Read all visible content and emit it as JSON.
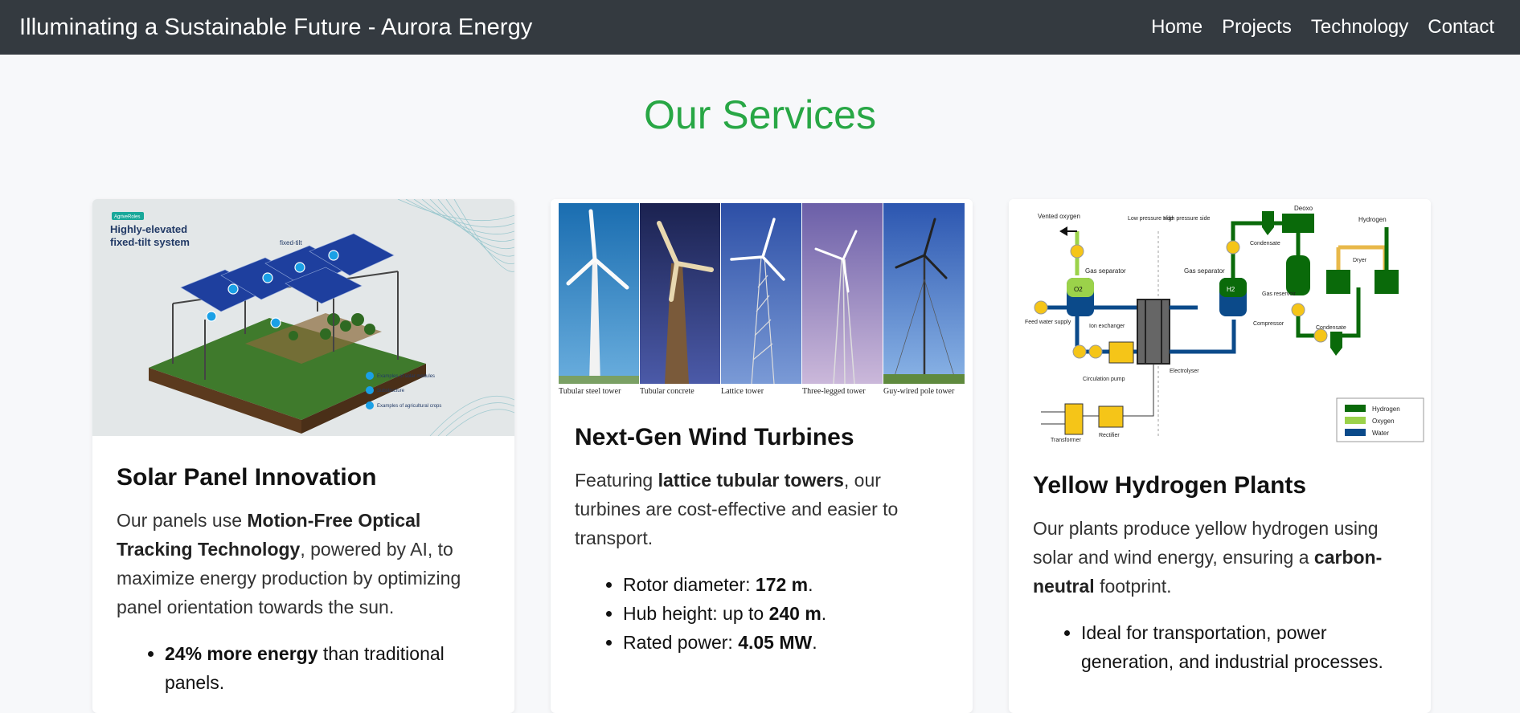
{
  "header": {
    "title": "Illuminating a Sustainable Future - Aurora Energy",
    "nav": [
      "Home",
      "Projects",
      "Technology",
      "Contact"
    ]
  },
  "main": {
    "heading": "Our Services"
  },
  "cards": [
    {
      "image": {
        "badge": "AgriveRoles",
        "title_line1": "Highly-elevated",
        "title_line2": "fixed-tilt system",
        "callout": "fixed-tilt",
        "legend": [
          "Examples of solar modules",
          "Substructure",
          "Examples of agricultural crops"
        ]
      },
      "title": "Solar Panel Innovation",
      "text_1": "Our panels use ",
      "text_bold": "Motion-Free Optical Tracking Technology",
      "text_2": ", powered by AI, to maximize energy production by optimizing panel orientation towards the sun.",
      "list": [
        {
          "bold": "24% more energy",
          "rest": " than traditional panels."
        }
      ]
    },
    {
      "image": {
        "captions": [
          "Tubular steel tower",
          "Tubular concrete",
          "Lattice tower",
          "Three-legged tower",
          "Guy-wired pole tower"
        ]
      },
      "title": "Next-Gen Wind Turbines",
      "text_1": "Featuring ",
      "text_bold": "lattice tubular towers",
      "text_2": ", our turbines are cost-effective and easier to transport.",
      "list": [
        {
          "pre": "Rotor diameter: ",
          "bold": "172 m",
          "post": "."
        },
        {
          "pre": "Hub height: up to ",
          "bold": "240 m",
          "post": "."
        },
        {
          "pre": "Rated power: ",
          "bold": "4.05 MW",
          "post": "."
        }
      ]
    },
    {
      "image": {
        "labels": {
          "vented_oxygen": "Vented oxygen",
          "low_pressure": "Low pressure side",
          "high_pressure": "High pressure side",
          "deoxo": "Deoxo",
          "hydrogen": "Hydrogen",
          "gas_separator_left": "Gas separator",
          "gas_separator_right": "Gas separator",
          "condensate_top": "Condensate",
          "dryer": "Dryer",
          "gas_reservoir": "Gas reservoir",
          "feed_water": "Feed water supply",
          "ion_exchanger": "Ion exchanger",
          "compressor": "Compressor",
          "condensate_bottom": "Condensate",
          "circulation_pump": "Circulation pump",
          "electrolyser": "Electrolyser",
          "transformer": "Transformer",
          "rectifier": "Rectifier",
          "o2": "O2",
          "h2": "H2"
        },
        "legend": [
          "Hydrogen",
          "Oxygen",
          "Water"
        ],
        "colors": {
          "hydrogen": "#0a6a0a",
          "oxygen": "#9bd24a",
          "water": "#0b4a8a",
          "component": "#f5c518"
        }
      },
      "title": "Yellow Hydrogen Plants",
      "text_1": "Our plants produce yellow hydrogen using solar and wind energy, ensuring a ",
      "text_bold": "carbon-neutral",
      "text_2": " footprint.",
      "list": [
        {
          "rest": "Ideal for transportation, power generation, and industrial processes."
        }
      ]
    }
  ]
}
